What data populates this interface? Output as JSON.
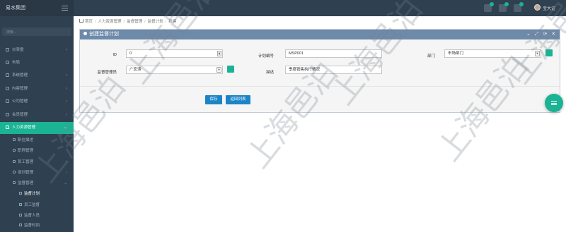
{
  "app": {
    "brand": "易水集团"
  },
  "header": {
    "user_name": "宝大证",
    "icons": [
      "bell-icon",
      "message-icon",
      "task-icon"
    ]
  },
  "sidebar": {
    "search_placeholder": "搜索...",
    "items": [
      {
        "label": "仪表盘",
        "icon": "dashboard-icon",
        "has_arrow": true
      },
      {
        "label": "布局",
        "icon": "layout-icon",
        "has_arrow": false
      },
      {
        "label": "系统管理",
        "icon": "system-icon",
        "has_arrow": true
      },
      {
        "label": "内容管理",
        "icon": "content-icon",
        "has_arrow": true
      },
      {
        "label": "公司管理",
        "icon": "company-icon",
        "has_arrow": true
      },
      {
        "label": "会员管理",
        "icon": "member-icon",
        "has_arrow": true
      },
      {
        "label": "人力资源管理",
        "icon": "hr-icon",
        "has_arrow": true,
        "active": true
      }
    ],
    "sub_items": [
      {
        "label": "职位描述",
        "icon": "position-icon"
      },
      {
        "label": "职称管理",
        "icon": "title-icon"
      },
      {
        "label": "员工管理",
        "icon": "employee-icon",
        "has_arrow": true
      },
      {
        "label": "培训管理",
        "icon": "training-icon",
        "has_arrow": true
      },
      {
        "label": "监督管理",
        "icon": "supervision-icon",
        "has_arrow": true
      }
    ],
    "subsub_items": [
      {
        "label": "监督计划",
        "icon": "plan-icon",
        "current": true
      },
      {
        "label": "员工监督",
        "icon": "staff-icon"
      },
      {
        "label": "监督人员",
        "icon": "people-icon"
      },
      {
        "label": "监督时间",
        "icon": "clock-icon"
      }
    ]
  },
  "breadcrumb": [
    "首页",
    "人力资源管理",
    "监督管理",
    "监督计划",
    "新建"
  ],
  "panel": {
    "title": "创建监督计划",
    "tools": "⌄ ⤢ ⟳ ✕"
  },
  "form": {
    "id_label": "ID",
    "id_value": "0",
    "plan_no_label": "计划编号",
    "plan_no_value": "MSP001",
    "dept_label": "部门",
    "dept_value": "市场部门",
    "manager_label": "监督管理员",
    "manager_value": "广宏涛",
    "desc_label": "描述",
    "desc_value": "季度销售执行情况"
  },
  "buttons": {
    "save": "保存",
    "back": "返回列表"
  },
  "colors": {
    "sidebar_bg": "#2f4050",
    "accent": "#1ab394",
    "panel_header": "#6e8aab",
    "primary_button": "#1c84c6"
  },
  "watermark": "上海邑泊"
}
